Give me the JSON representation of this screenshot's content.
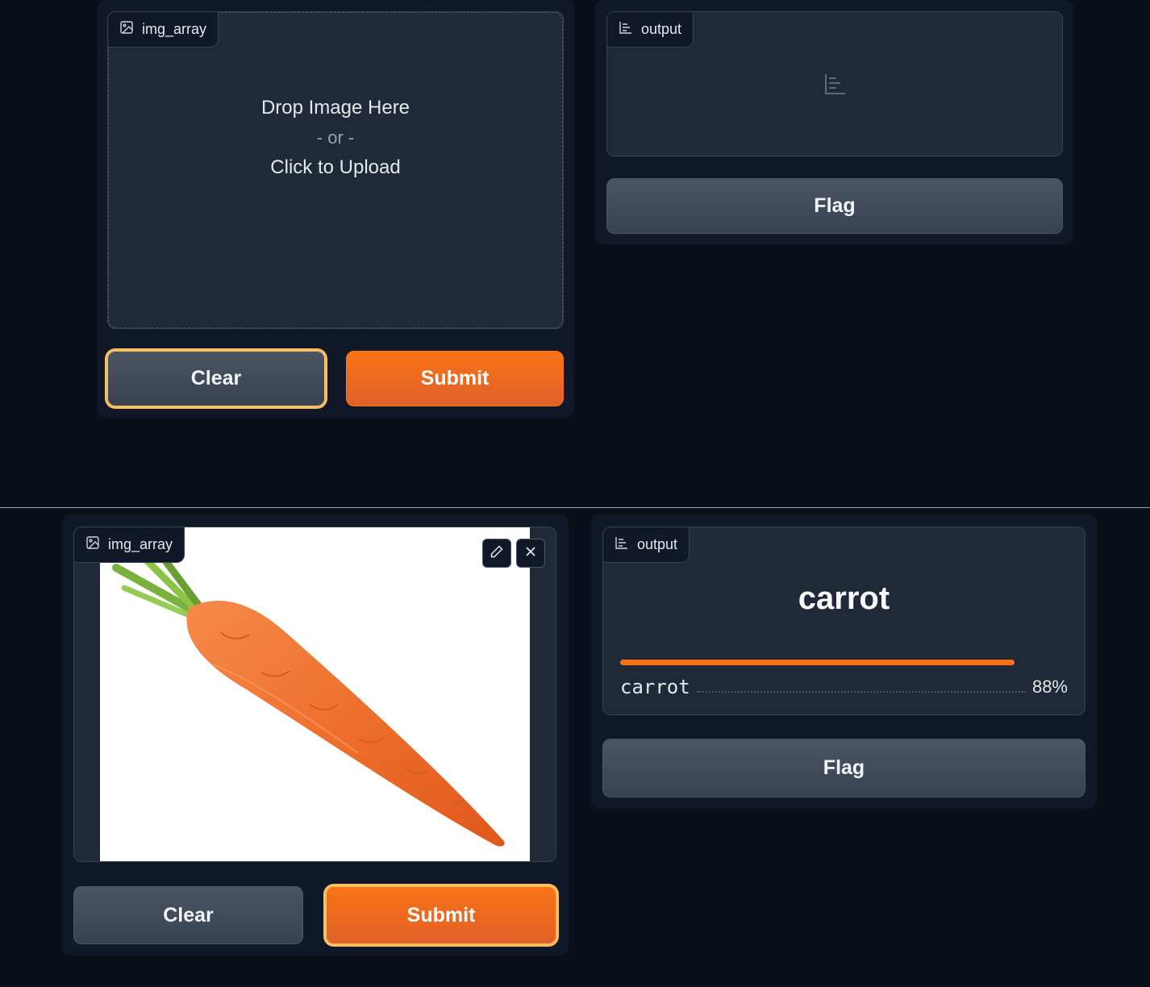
{
  "top": {
    "input": {
      "label": "img_array",
      "drop_text": "Drop Image Here",
      "or_text": "- or -",
      "upload_text": "Click to Upload"
    },
    "output": {
      "label": "output"
    },
    "buttons": {
      "clear": "Clear",
      "submit": "Submit",
      "flag": "Flag"
    }
  },
  "bottom": {
    "input": {
      "label": "img_array",
      "image_alt": "carrot"
    },
    "output": {
      "label": "output",
      "predicted_label": "carrot",
      "confidences": [
        {
          "label": "carrot",
          "percent_text": "88%",
          "value": 0.88
        }
      ]
    },
    "buttons": {
      "clear": "Clear",
      "submit": "Submit",
      "flag": "Flag"
    }
  },
  "colors": {
    "accent": "#f97316",
    "focus_ring": "#fbbf63",
    "background": "#0b0f19"
  },
  "icons": [
    "image-icon",
    "bar-chart-icon",
    "edit-icon",
    "close-icon"
  ]
}
